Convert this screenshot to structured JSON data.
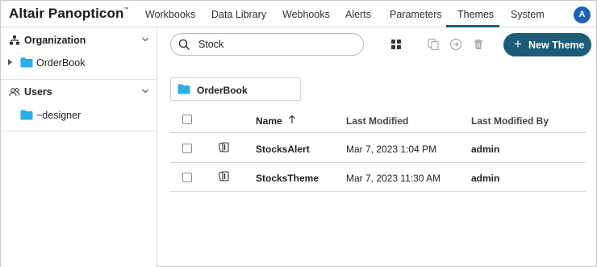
{
  "app": {
    "brand": "Altair Panopticon",
    "brand_tm": "™",
    "user_initial": "A",
    "accent_color": "#1c5c77",
    "avatar_color": "#1f5fb8",
    "folder_color": "#29aee6"
  },
  "nav": {
    "items": [
      {
        "label": "Workbooks"
      },
      {
        "label": "Data Library"
      },
      {
        "label": "Webhooks"
      },
      {
        "label": "Alerts"
      },
      {
        "label": "Parameters"
      },
      {
        "label": "Themes",
        "active": true
      },
      {
        "label": "System"
      }
    ]
  },
  "sidebar": {
    "organization": {
      "label": "Organization",
      "icon": "org-tree-icon",
      "items": [
        {
          "label": "OrderBook",
          "icon": "folder-icon"
        }
      ]
    },
    "users": {
      "label": "Users",
      "icon": "users-icon",
      "items": [
        {
          "label": "~designer",
          "icon": "folder-icon"
        }
      ]
    }
  },
  "toolbar": {
    "search_value": "Stock",
    "new_button_label": "New Theme",
    "icons": [
      "grid-view-icon",
      "copy-icon",
      "move-icon",
      "delete-icon"
    ]
  },
  "folder_tile": {
    "label": "OrderBook"
  },
  "table": {
    "columns": [
      "Name",
      "Last Modified",
      "Last Modified By"
    ],
    "sort_column": "Name",
    "sort_direction": "ascending",
    "rows": [
      {
        "name": "StocksAlert",
        "modified": "Mar 7, 2023 1:04 PM",
        "by": "admin",
        "icon": "theme-icon"
      },
      {
        "name": "StocksTheme",
        "modified": "Mar 7, 2023 11:30 AM",
        "by": "admin",
        "icon": "theme-icon"
      }
    ]
  }
}
